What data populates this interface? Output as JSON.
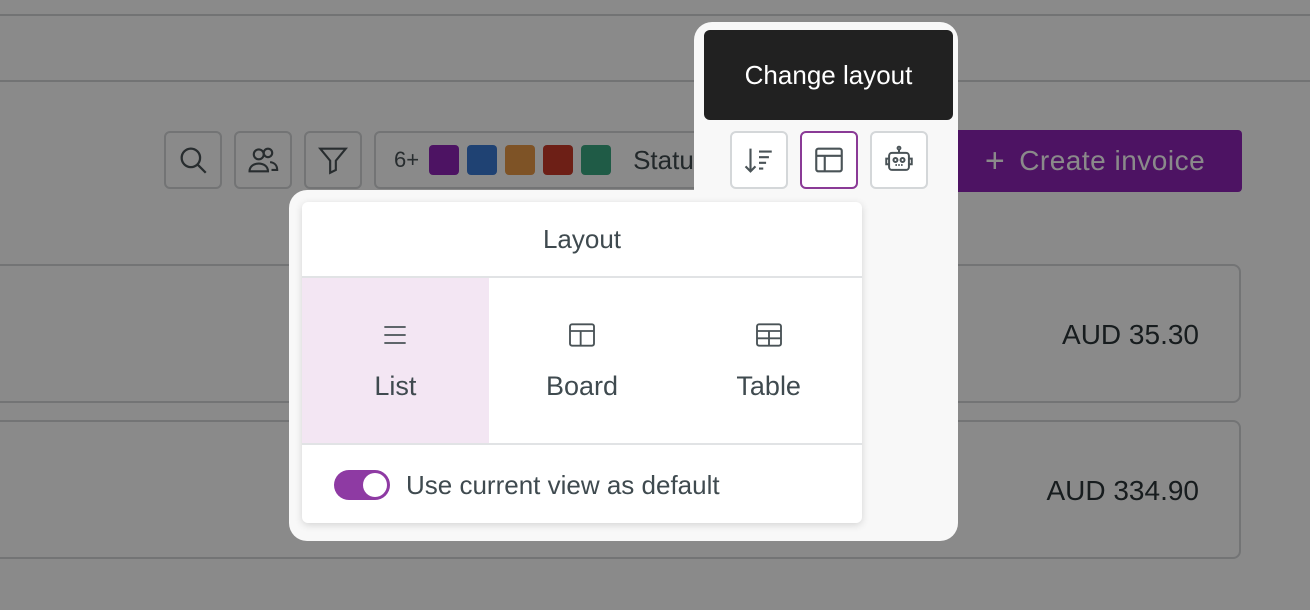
{
  "toolbar": {
    "icons": [
      "search-icon",
      "users-icon",
      "filter-icon",
      "sort-icon",
      "layout-icon",
      "bot-icon"
    ],
    "status_filter": {
      "more_label": "6+",
      "swatches": [
        "#8e24b8",
        "#3a7bd5",
        "#e99a47",
        "#c93a2a",
        "#3aa882"
      ],
      "label": "Status"
    },
    "create_button_label": "Create invoice"
  },
  "rows": [
    {
      "amount": "AUD 35.30"
    },
    {
      "amount": "AUD 334.90"
    }
  ],
  "tooltip": {
    "text": "Change layout"
  },
  "layout_menu": {
    "title": "Layout",
    "options": [
      {
        "label": "List",
        "icon": "list-icon",
        "selected": true
      },
      {
        "label": "Board",
        "icon": "board-icon",
        "selected": false
      },
      {
        "label": "Table",
        "icon": "table-icon",
        "selected": false
      }
    ],
    "default_toggle": {
      "label": "Use current view as default",
      "on": true
    }
  },
  "colors": {
    "accent": "#8e24b8",
    "overlay": "rgba(0,0,0,0.46)"
  }
}
